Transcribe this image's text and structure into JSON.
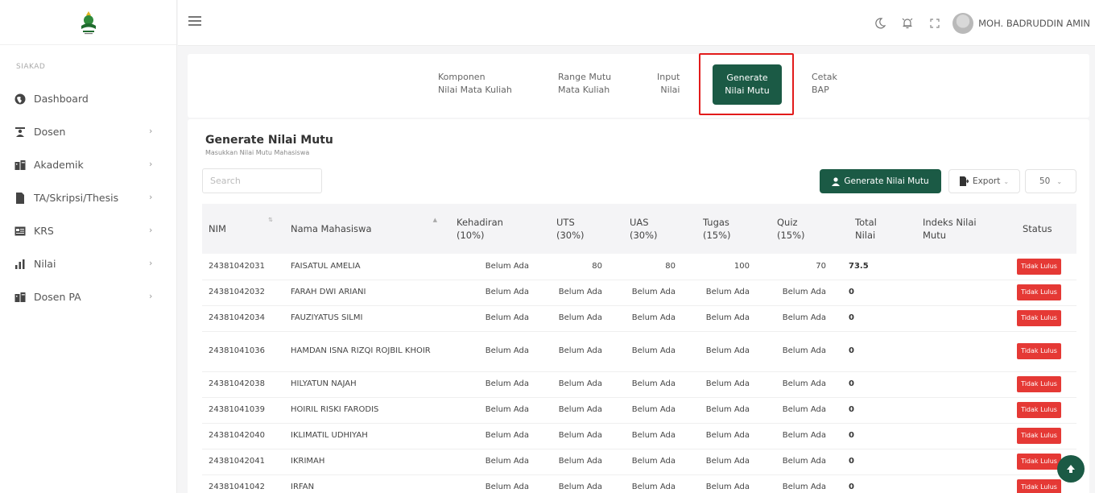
{
  "sidebar": {
    "section_label": "SIAKAD",
    "items": [
      {
        "label": "Dashboard",
        "icon": "globe-icon",
        "chevron": false
      },
      {
        "label": "Dosen",
        "icon": "teacher-icon",
        "chevron": true
      },
      {
        "label": "Akademik",
        "icon": "building-icon",
        "chevron": true
      },
      {
        "label": "TA/Skripsi/Thesis",
        "icon": "file-icon",
        "chevron": true
      },
      {
        "label": "KRS",
        "icon": "card-icon",
        "chevron": true
      },
      {
        "label": "Nilai",
        "icon": "bar-chart-icon",
        "chevron": true
      },
      {
        "label": "Dosen PA",
        "icon": "building-icon",
        "chevron": true
      }
    ]
  },
  "topbar": {
    "username": "MOH. BADRUDDIN AMIN",
    "icons": [
      "menu-icon",
      "moon-icon",
      "bell-icon",
      "fullscreen-icon",
      "avatar"
    ]
  },
  "tabs": [
    {
      "line1": "Komponen",
      "line2": "Nilai Mata Kuliah"
    },
    {
      "line1": "Range Mutu",
      "line2": "Mata Kuliah"
    },
    {
      "line1": "Input",
      "line2": "Nilai"
    },
    {
      "line1": "Generate",
      "line2": "Nilai Mutu",
      "active": true
    },
    {
      "line1": "Cetak",
      "line2": "BAP"
    }
  ],
  "card": {
    "title": "Generate Nilai Mutu",
    "subtitle": "Masukkan Nilai Mutu Mahasiswa",
    "search_placeholder": "Search",
    "generate_label": "Generate Nilai Mutu",
    "export_label": "Export",
    "per_page": "50"
  },
  "table": {
    "headers": [
      {
        "line1": "NIM",
        "line2": ""
      },
      {
        "line1": "Nama Mahasiswa",
        "line2": ""
      },
      {
        "line1": "Kehadiran",
        "line2": "(10%)"
      },
      {
        "line1": "UTS",
        "line2": "(30%)"
      },
      {
        "line1": "UAS",
        "line2": "(30%)"
      },
      {
        "line1": "Tugas",
        "line2": "(15%)"
      },
      {
        "line1": "Quiz",
        "line2": "(15%)"
      },
      {
        "line1": "Total",
        "line2": "Nilai"
      },
      {
        "line1": "Indeks Nilai",
        "line2": "Mutu"
      },
      {
        "line1": "Status",
        "line2": ""
      }
    ],
    "rows": [
      {
        "nim": "24381042031",
        "nama": "FAISATUL AMELIA",
        "kehadiran": "Belum Ada",
        "uts": "80",
        "uas": "80",
        "tugas": "100",
        "quiz": "70",
        "total": "73.5",
        "indeks": "",
        "status": "Tidak Lulus"
      },
      {
        "nim": "24381042032",
        "nama": "FARAH DWI ARIANI",
        "kehadiran": "Belum Ada",
        "uts": "Belum Ada",
        "uas": "Belum Ada",
        "tugas": "Belum Ada",
        "quiz": "Belum Ada",
        "total": "0",
        "indeks": "",
        "status": "Tidak Lulus"
      },
      {
        "nim": "24381042034",
        "nama": "FAUZIYATUS SILMI",
        "kehadiran": "Belum Ada",
        "uts": "Belum Ada",
        "uas": "Belum Ada",
        "tugas": "Belum Ada",
        "quiz": "Belum Ada",
        "total": "0",
        "indeks": "",
        "status": "Tidak Lulus"
      },
      {
        "nim": "24381041036",
        "nama": "HAMDAN ISNA RIZQI ROJBIL KHOIR",
        "kehadiran": "Belum Ada",
        "uts": "Belum Ada",
        "uas": "Belum Ada",
        "tugas": "Belum Ada",
        "quiz": "Belum Ada",
        "total": "0",
        "indeks": "",
        "status": "Tidak Lulus"
      },
      {
        "nim": "24381042038",
        "nama": "HILYATUN NAJAH",
        "kehadiran": "Belum Ada",
        "uts": "Belum Ada",
        "uas": "Belum Ada",
        "tugas": "Belum Ada",
        "quiz": "Belum Ada",
        "total": "0",
        "indeks": "",
        "status": "Tidak Lulus"
      },
      {
        "nim": "24381041039",
        "nama": "HOIRIL RISKI FARODIS",
        "kehadiran": "Belum Ada",
        "uts": "Belum Ada",
        "uas": "Belum Ada",
        "tugas": "Belum Ada",
        "quiz": "Belum Ada",
        "total": "0",
        "indeks": "",
        "status": "Tidak Lulus"
      },
      {
        "nim": "24381042040",
        "nama": "IKLIMATIL UDHIYAH",
        "kehadiran": "Belum Ada",
        "uts": "Belum Ada",
        "uas": "Belum Ada",
        "tugas": "Belum Ada",
        "quiz": "Belum Ada",
        "total": "0",
        "indeks": "",
        "status": "Tidak Lulus"
      },
      {
        "nim": "24381042041",
        "nama": "IKRIMAH",
        "kehadiran": "Belum Ada",
        "uts": "Belum Ada",
        "uas": "Belum Ada",
        "tugas": "Belum Ada",
        "quiz": "Belum Ada",
        "total": "0",
        "indeks": "",
        "status": "Tidak Lulus"
      },
      {
        "nim": "24381041042",
        "nama": "IRFAN",
        "kehadiran": "Belum Ada",
        "uts": "Belum Ada",
        "uas": "Belum Ada",
        "tugas": "Belum Ada",
        "quiz": "Belum Ada",
        "total": "0",
        "indeks": "",
        "status": "Tidak Lulus"
      }
    ]
  },
  "colors": {
    "primary": "#1b5a45",
    "danger": "#e53935",
    "highlight": "#e21b1b"
  }
}
